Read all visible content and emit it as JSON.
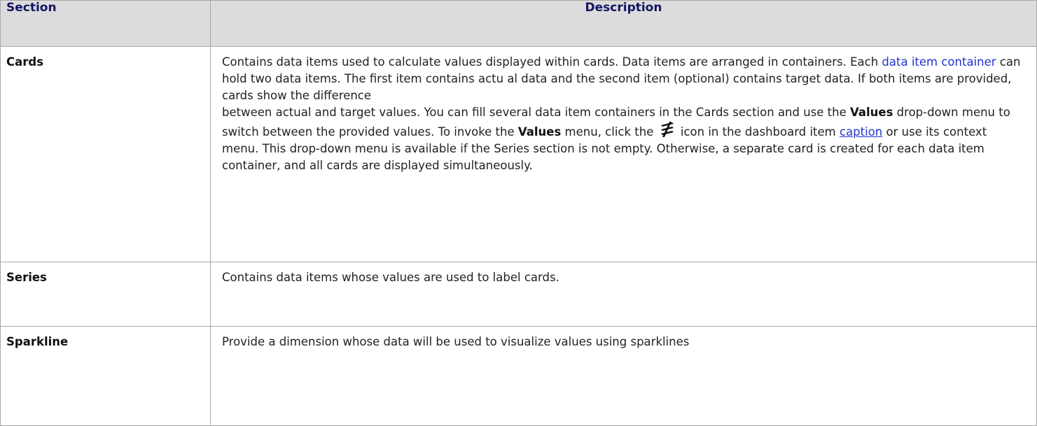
{
  "table": {
    "headers": {
      "section": "Section",
      "description": "Description"
    },
    "rows": [
      {
        "section": "Cards",
        "desc": {
          "p1_a": "Contains data items used to calculate  values displayed within cards. Data items are arranged in containers. Each ",
          "p1_link": "data item container",
          "p1_b": " can hold two data items. The first item contains actu al data and the second item (optional) contains target data. If both items are provided, cards show the  difference",
          "p2_a": "between actual and target values. You can fill several data item containers in the Cards section and use  the ",
          "p2_bold1": "Values",
          "p2_b": " drop-down menu to switch between the provided values. To invoke the ",
          "p2_bold2": "Values",
          "p2_c": " menu,  click the ",
          "p2_d": " icon in the dashboard item ",
          "p2_link": "caption",
          "p2_e": " or use its context menu. This drop-down menu is available if the Series section is not empty. Otherwise, a separate card is created for each data item container, and all cards are displayed simultaneously."
        },
        "icon": "values-menu-icon"
      },
      {
        "section": "Series",
        "desc": "Contains data items whose values are used to label cards."
      },
      {
        "section": "Sparkline",
        "desc": "Provide a dimension whose data will be used to visualize values using sparklines"
      }
    ]
  },
  "colors": {
    "header_bg": "#dcdcdc",
    "header_text": "#141464",
    "link": "#2233cc",
    "border": "#a6a6a6"
  }
}
